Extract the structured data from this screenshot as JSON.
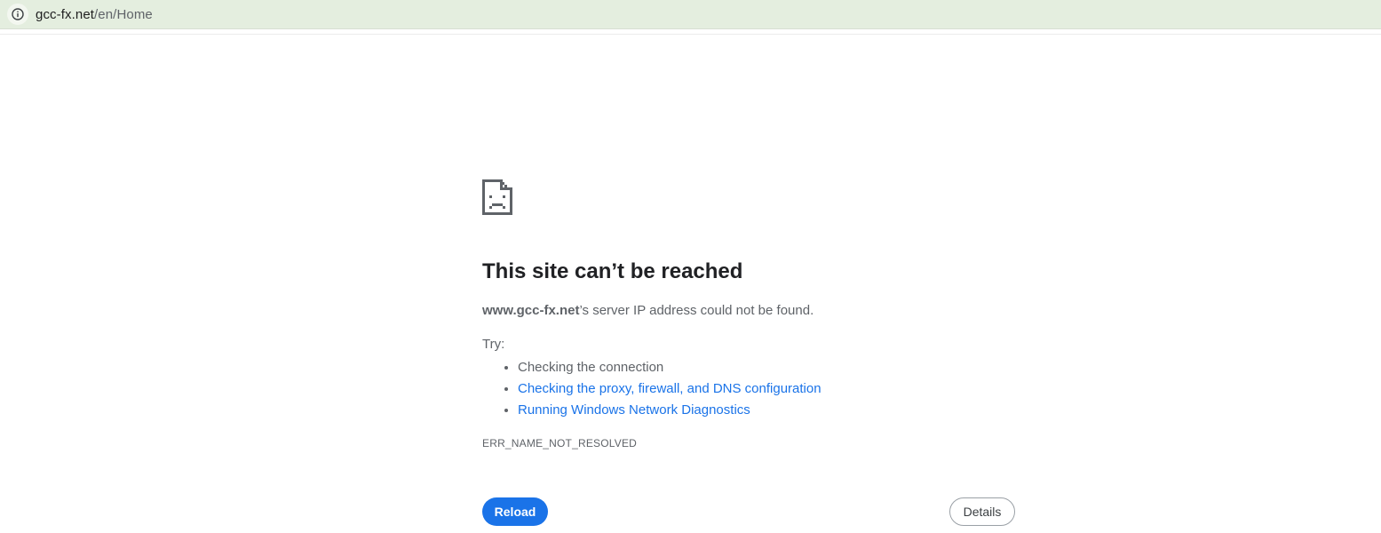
{
  "address_bar": {
    "host": "gcc-fx.net",
    "path": "/en/Home",
    "icon": "info-icon"
  },
  "error_page": {
    "icon": "sad-document-icon",
    "title": "This site can’t be reached",
    "summary_host": "www.gcc-fx.net",
    "summary_rest": "’s server IP address could not be found.",
    "try_label": "Try:",
    "suggestions": [
      {
        "text": "Checking the connection",
        "is_link": false
      },
      {
        "text": "Checking the proxy, firewall, and DNS configuration",
        "is_link": true
      },
      {
        "text": "Running Windows Network Diagnostics",
        "is_link": true
      }
    ],
    "error_code": "ERR_NAME_NOT_RESOLVED",
    "reload_label": "Reload",
    "details_label": "Details"
  },
  "colors": {
    "accent": "#1a73e8",
    "topbar": "#e4eedf"
  }
}
